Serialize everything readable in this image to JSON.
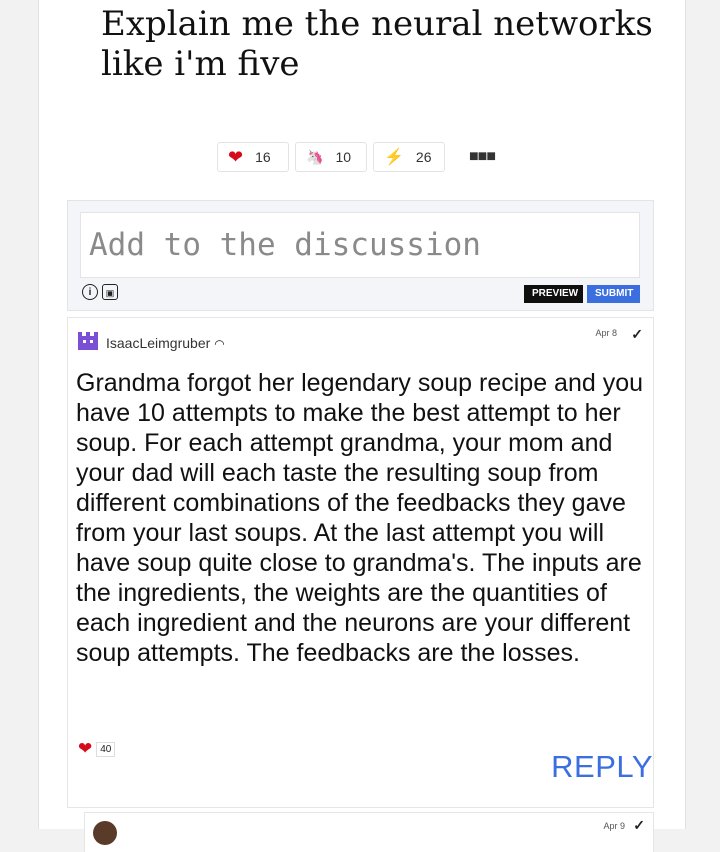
{
  "post": {
    "title": "Explain me the neural networks like i'm five"
  },
  "reactions": [
    {
      "icon": "heart-icon",
      "count": "16",
      "color": "#d50b19"
    },
    {
      "icon": "unicorn-icon",
      "count": "10"
    },
    {
      "icon": "bookmark-icon",
      "count": "26",
      "color": "#3b6fe0"
    }
  ],
  "composer": {
    "placeholder": "Add to the discussion",
    "preview_label": "PREVIEW",
    "submit_label": "SUBMIT"
  },
  "comment": {
    "username": "IsaacLeimgruber",
    "date": "Apr 8",
    "text": "Grandma forgot her legendary soup recipe and you have 10 attempts to make the best attempt to her soup. For each attempt grandma, your mom and your dad will each taste the resulting soup from different combinations of the feedbacks they gave from your last soups. At the last attempt you will have soup quite close to grandma's. The inputs are the ingredients, the weights are the quantities of each ingredient and the neurons are your different soup attempts. The feedbacks are the losses.",
    "likes": "40",
    "reply_label": "REPLY"
  },
  "next_comment": {
    "date": "Apr 9"
  },
  "colors": {
    "accent": "#3b6fe0",
    "heart": "#d50b19"
  }
}
